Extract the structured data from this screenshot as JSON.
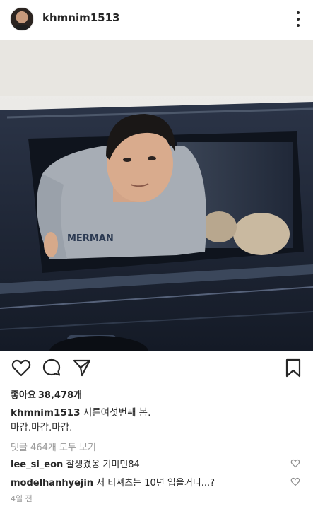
{
  "header": {
    "username": "khmnim1513",
    "avatar_icon": "profile-avatar",
    "menu_icon": "more-vertical-icon"
  },
  "photo": {
    "shirt_text": "MERMAN"
  },
  "actions": {
    "like_icon": "heart-icon",
    "comment_icon": "comment-icon",
    "share_icon": "send-icon",
    "save_icon": "bookmark-icon"
  },
  "likes": {
    "label": "좋아요",
    "count": "38,478개"
  },
  "caption": {
    "username": "khmnim1513",
    "line1": "서른여섯번째 봄.",
    "line2": "마감.마감.마감."
  },
  "view_all": "댓글 464개 모두 보기",
  "comments": [
    {
      "username": "lee_si_eon",
      "text": "잘생겼옹 기미민84"
    },
    {
      "username": "modelhanhyejin",
      "text": "저 티셔츠는 10년 입을거니...?"
    }
  ],
  "timestamp": "4일 전",
  "colors": {
    "text": "#262626",
    "muted": "#999999",
    "car": "#1f2a3d"
  }
}
